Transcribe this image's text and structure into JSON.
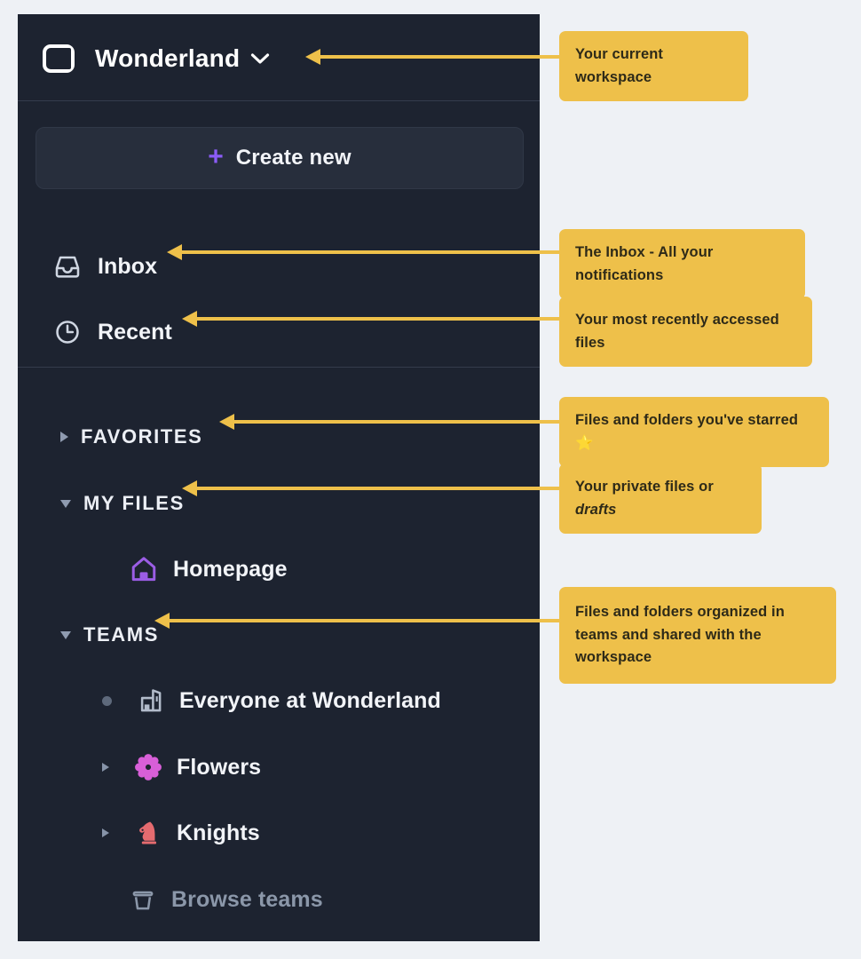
{
  "colors": {
    "page_background": "#eef1f5",
    "sidebar_background": "#1d2330",
    "callout_background": "#eec04a",
    "callout_text": "#2e2a18",
    "arrow": "#eec04a",
    "accent_purple": "#8b5cf6",
    "homepage_icon": "#9b5de5",
    "flowers_icon": "#d85fd8",
    "knights_icon": "#e56b6f",
    "muted_text": "#8b97a9",
    "primary_text": "#f2f4f8"
  },
  "sidebar": {
    "workspace": {
      "name": "Wonderland",
      "icon": "panel-layout-icon",
      "chevron": "chevron-down-icon"
    },
    "create_new": {
      "label": "Create new",
      "icon": "plus-icon"
    },
    "nav_items": [
      {
        "label": "Inbox",
        "icon": "inbox-icon"
      },
      {
        "label": "Recent",
        "icon": "clock-icon"
      }
    ],
    "sections": [
      {
        "label": "FAVORITES",
        "expanded": false,
        "disclosure": "triangle-right-icon",
        "items": []
      },
      {
        "label": "MY FILES",
        "expanded": true,
        "disclosure": "triangle-down-icon",
        "items": [
          {
            "label": "Homepage",
            "icon": "home-icon",
            "disclosure": "none"
          }
        ]
      },
      {
        "label": "TEAMS",
        "expanded": true,
        "disclosure": "triangle-down-icon",
        "items": [
          {
            "label": "Everyone at Wonderland",
            "icon": "building-icon",
            "disclosure": "bullet-dot"
          },
          {
            "label": "Flowers",
            "icon": "flower-icon",
            "disclosure": "triangle-right-icon"
          },
          {
            "label": "Knights",
            "icon": "chess-knight-icon",
            "disclosure": "triangle-right-icon"
          },
          {
            "label": "Browse teams",
            "icon": "basket-icon",
            "disclosure": "none",
            "muted": true
          }
        ]
      }
    ]
  },
  "callouts": {
    "workspace": "Your current workspace",
    "inbox": "The Inbox - All your notifications",
    "recent": "Your most recently accessed files",
    "favorites_prefix": "Files and folders you've starred ",
    "favorites_star": "⭐",
    "myfiles_prefix": "Your private files or ",
    "myfiles_emphasis": "drafts",
    "teams": "Files and folders organized in teams and shared with the workspace"
  }
}
